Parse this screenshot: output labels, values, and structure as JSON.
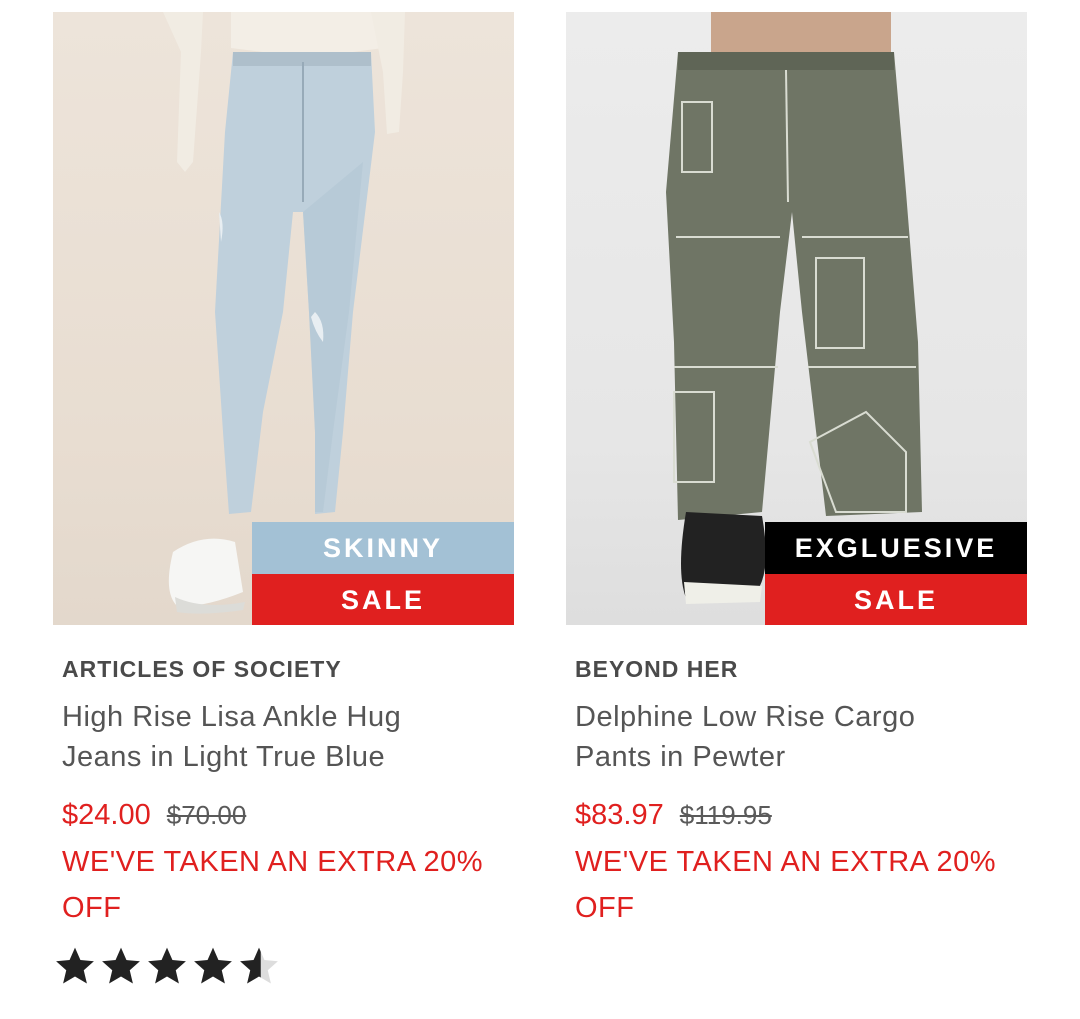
{
  "products": [
    {
      "image_alt": "Light blue skinny jeans",
      "badge_top": {
        "label": "SKINNY",
        "color": "#a3c1d5"
      },
      "badge_bottom": {
        "label": "SALE",
        "color": "#e0201f"
      },
      "brand": "ARTICLES OF SOCIETY",
      "name": "High Rise Lisa Ankle Hug Jeans in Light True Blue",
      "price_now": "$24.00",
      "price_was": "$70.00",
      "promo": "WE'VE TAKEN AN EXTRA 20% OFF",
      "rating": 4.5
    },
    {
      "image_alt": "Pewter cargo pants",
      "badge_top": {
        "label": "EXGLUESIVE",
        "color": "#000000"
      },
      "badge_bottom": {
        "label": "SALE",
        "color": "#e0201f"
      },
      "brand": "BEYOND HER",
      "name": "Delphine Low Rise Cargo Pants in Pewter",
      "price_now": "$83.97",
      "price_was": "$119.95",
      "promo": "WE'VE TAKEN AN EXTRA 20% OFF"
    }
  ]
}
